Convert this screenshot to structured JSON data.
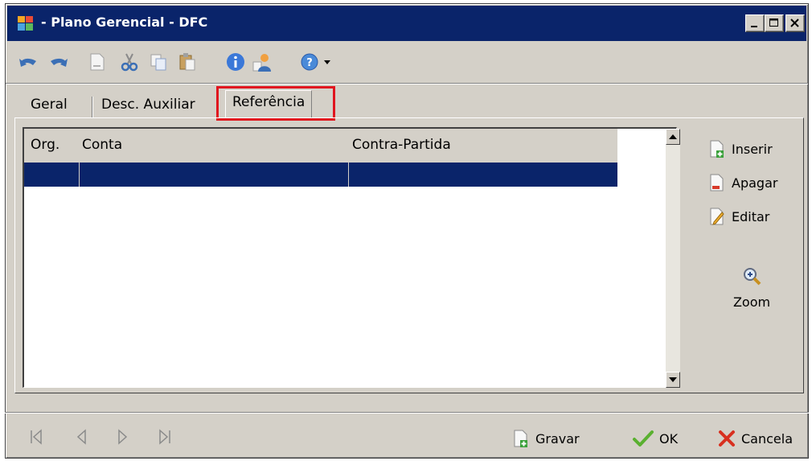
{
  "window": {
    "title": "- Plano Gerencial - DFC",
    "controls": {
      "minimize": "minimize-icon",
      "maximize": "maximize-icon",
      "close": "close-icon"
    }
  },
  "toolbar": {
    "icons": [
      "undo-icon",
      "redo-icon",
      "new-document-icon",
      "cut-icon",
      "copy-icon",
      "paste-icon",
      "info-icon",
      "user-icon",
      "help-icon",
      "dropdown-arrow-icon"
    ]
  },
  "tabs": [
    {
      "label": "Geral",
      "active": false
    },
    {
      "label": "Desc. Auxiliar",
      "active": false
    },
    {
      "label": "Referência",
      "active": true
    }
  ],
  "grid": {
    "columns": [
      "Org.",
      "Conta",
      "Contra-Partida"
    ],
    "rows": [
      [
        "",
        "",
        ""
      ]
    ]
  },
  "side_buttons": {
    "insert": "Inserir",
    "delete": "Apagar",
    "edit": "Editar",
    "zoom": "Zoom"
  },
  "bottom_bar": {
    "nav_icons": [
      "first-record-icon",
      "previous-record-icon",
      "next-record-icon",
      "last-record-icon"
    ],
    "save": "Gravar",
    "ok": "OK",
    "cancel": "Cancela"
  },
  "colors": {
    "titlebar": "#0a246a",
    "selection": "#0a246a",
    "face": "#d4d0c8",
    "highlight_box": "#e0141e"
  }
}
